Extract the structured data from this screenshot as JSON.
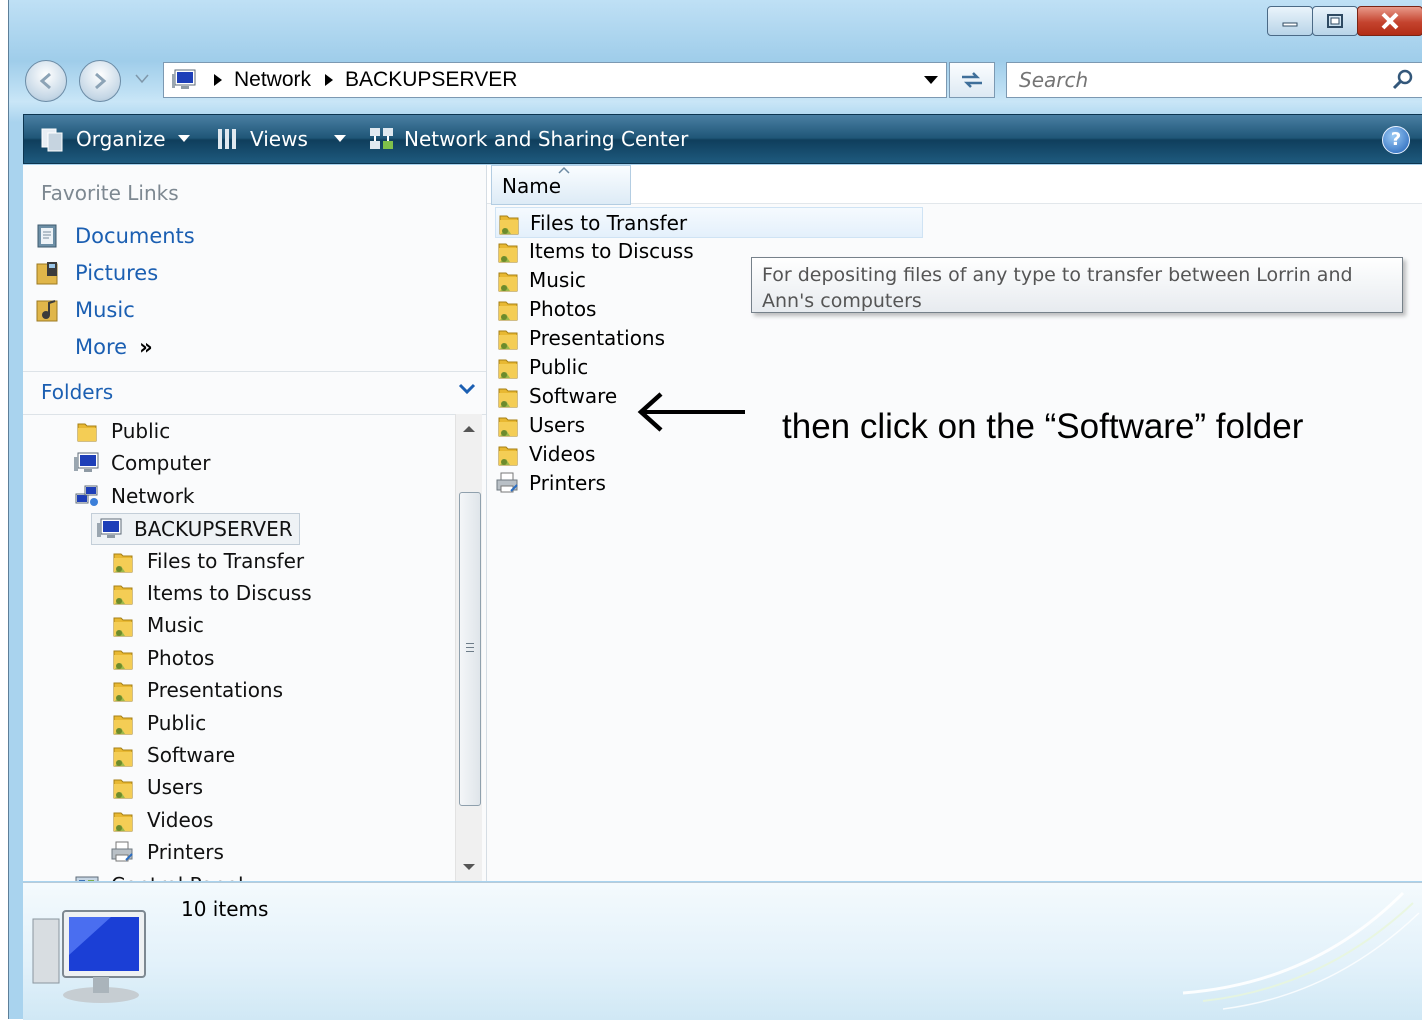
{
  "window": {
    "title_buttons": {
      "minimize": "minimize-icon",
      "maximize": "maximize-icon",
      "close": "close-icon"
    }
  },
  "nav": {
    "address": {
      "root_icon": "computer-icon",
      "segments": [
        "Network",
        "BACKUPSERVER"
      ]
    },
    "search": {
      "placeholder": "Search"
    }
  },
  "toolbar": {
    "organize": "Organize",
    "views": "Views",
    "network_center": "Network and Sharing Center"
  },
  "sidebar": {
    "favorite_links_title": "Favorite Links",
    "favorites": [
      {
        "label": "Documents",
        "icon": "documents-icon"
      },
      {
        "label": "Pictures",
        "icon": "pictures-icon"
      },
      {
        "label": "Music",
        "icon": "music-icon"
      }
    ],
    "more": "More",
    "more_glyph": "»",
    "folders_title": "Folders",
    "tree": [
      {
        "label": "Public",
        "icon": "folder-icon"
      },
      {
        "label": "Computer",
        "icon": "computer-icon"
      },
      {
        "label": "Network",
        "icon": "network-icon"
      },
      {
        "label": "BACKUPSERVER",
        "icon": "computer-icon",
        "selected": true
      },
      {
        "label": "Files to Transfer",
        "icon": "shared-folder-icon"
      },
      {
        "label": "Items to Discuss",
        "icon": "shared-folder-icon"
      },
      {
        "label": "Music",
        "icon": "shared-folder-icon"
      },
      {
        "label": "Photos",
        "icon": "shared-folder-icon"
      },
      {
        "label": "Presentations",
        "icon": "shared-folder-icon"
      },
      {
        "label": "Public",
        "icon": "shared-folder-icon"
      },
      {
        "label": "Software",
        "icon": "shared-folder-icon"
      },
      {
        "label": "Users",
        "icon": "shared-folder-icon"
      },
      {
        "label": "Videos",
        "icon": "shared-folder-icon"
      },
      {
        "label": "Printers",
        "icon": "printers-icon"
      },
      {
        "label": "Control Panel",
        "icon": "control-panel-icon"
      }
    ]
  },
  "main": {
    "column_header": "Name",
    "items": [
      {
        "label": "Files to Transfer",
        "icon": "shared-folder-icon",
        "hover": true
      },
      {
        "label": "Items to Discuss",
        "icon": "shared-folder-icon"
      },
      {
        "label": "Music",
        "icon": "shared-folder-icon"
      },
      {
        "label": "Photos",
        "icon": "shared-folder-icon"
      },
      {
        "label": "Presentations",
        "icon": "shared-folder-icon"
      },
      {
        "label": "Public",
        "icon": "shared-folder-icon"
      },
      {
        "label": "Software",
        "icon": "shared-folder-icon"
      },
      {
        "label": "Users",
        "icon": "shared-folder-icon"
      },
      {
        "label": "Videos",
        "icon": "shared-folder-icon"
      },
      {
        "label": "Printers",
        "icon": "printers-icon"
      }
    ],
    "tooltip": "For depositing files of any type to transfer between Lorrin and Ann's computers",
    "annotation": "then click on the “Software” folder"
  },
  "details": {
    "item_count": "10 items"
  },
  "colors": {
    "link_blue": "#1b5fb2",
    "command_bar": "#1f5677",
    "folder_yellow": "#e8b832"
  }
}
